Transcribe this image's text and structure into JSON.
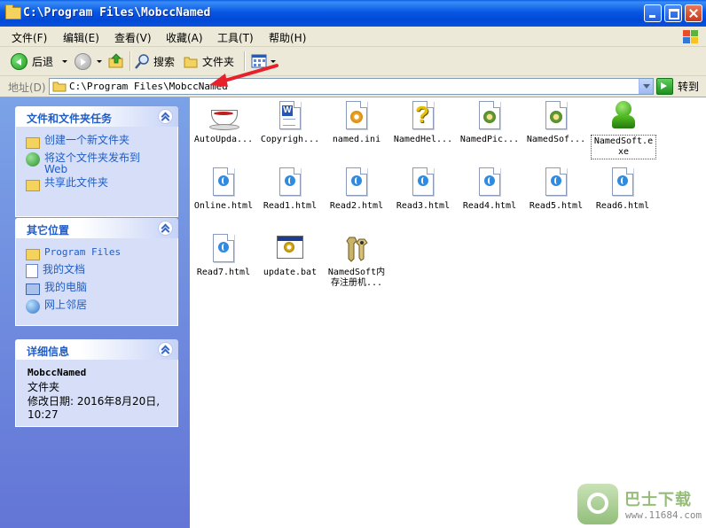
{
  "window": {
    "title": "C:\\Program Files\\MobccNamed",
    "buttons": [
      "minimize",
      "maximize",
      "close"
    ]
  },
  "menubar": {
    "items": [
      "文件(F)",
      "编辑(E)",
      "查看(V)",
      "收藏(A)",
      "工具(T)",
      "帮助(H)"
    ]
  },
  "toolbar": {
    "back_label": "后退",
    "search_label": "搜索",
    "folders_label": "文件夹"
  },
  "address": {
    "label": "地址(D)",
    "value": "C:\\Program Files\\MobccNamed",
    "go_label": "转到"
  },
  "sidebar": {
    "tasks": {
      "title": "文件和文件夹任务",
      "items": [
        "创建一个新文件夹",
        "将这个文件夹发布到 Web",
        "共享此文件夹"
      ]
    },
    "places": {
      "title": "其它位置",
      "items": [
        "Program Files",
        "我的文档",
        "我的电脑",
        "网上邻居"
      ]
    },
    "details": {
      "title": "详细信息",
      "name": "MobccNamed",
      "type": "文件夹",
      "modified": "修改日期: 2016年8月20日, 10:27"
    }
  },
  "files": [
    {
      "label": "AutoUpda...",
      "icon": "teacup-icon"
    },
    {
      "label": "Copyrigh...",
      "icon": "word-doc-icon"
    },
    {
      "label": "named.ini",
      "icon": "ini-settings-icon"
    },
    {
      "label": "NamedHel...",
      "icon": "help-file-icon"
    },
    {
      "label": "NamedPic...",
      "icon": "dll-gear-icon"
    },
    {
      "label": "NamedSof...",
      "icon": "dll-gear-icon"
    },
    {
      "label": "NamedSoft.exe",
      "icon": "robot-exe-icon",
      "selected": true
    },
    {
      "label": "Online.html",
      "icon": "html-doc-icon"
    },
    {
      "label": "Read1.html",
      "icon": "html-doc-icon"
    },
    {
      "label": "Read2.html",
      "icon": "html-doc-icon"
    },
    {
      "label": "Read3.html",
      "icon": "html-doc-icon"
    },
    {
      "label": "Read4.html",
      "icon": "html-doc-icon"
    },
    {
      "label": "Read5.html",
      "icon": "html-doc-icon"
    },
    {
      "label": "Read6.html",
      "icon": "html-doc-icon"
    },
    {
      "label": "Read7.html",
      "icon": "html-doc-icon"
    },
    {
      "label": "update.bat",
      "icon": "batch-file-icon"
    },
    {
      "label": "NamedSoft内存注册机...",
      "icon": "keys-icon"
    }
  ],
  "watermark": {
    "title": "巴士下载",
    "url": "www.11684.com"
  },
  "colors": {
    "titlebar": "#0049d6",
    "sidebar": "#6e8ddf",
    "link": "#215dc6",
    "annotation_arrow": "#e8202a"
  }
}
